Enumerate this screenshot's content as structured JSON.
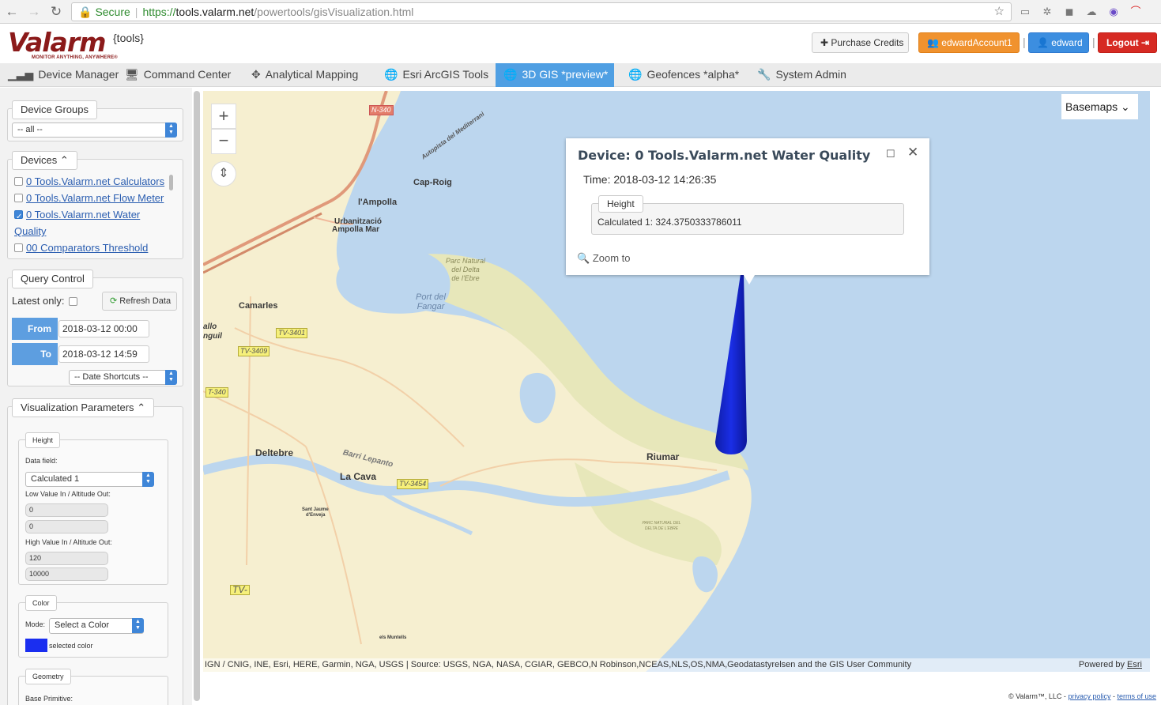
{
  "browser": {
    "secure_label": "Secure",
    "url_scheme": "https://",
    "url_host": "tools.valarm.net",
    "url_path": "/powertools/gisVisualization.html"
  },
  "header": {
    "logo_text": "Valarm",
    "logo_tagline": "MONITOR ANYTHING, ANYWHERE®",
    "tools_tag": "{tools}",
    "purchase_label": "Purchase Credits",
    "account_label": "edwardAccount1",
    "user_label": "edward",
    "logout_label": "Logout"
  },
  "tabs": [
    {
      "label": "Device Manager",
      "icon": "signal-bars-icon"
    },
    {
      "label": "Command Center",
      "icon": "monitor-icon"
    },
    {
      "label": "Analytical Mapping",
      "icon": "crosshair-icon"
    },
    {
      "label": "Esri ArcGIS Tools",
      "icon": "globe-icon"
    },
    {
      "label": "3D GIS *preview*",
      "icon": "globe-icon",
      "active": true
    },
    {
      "label": "Geofences *alpha*",
      "icon": "globe-icon"
    },
    {
      "label": "System Admin",
      "icon": "wrench-icon"
    }
  ],
  "sidebar": {
    "device_groups": {
      "legend": "Device Groups",
      "selected": "-- all --"
    },
    "devices": {
      "legend": "Devices",
      "items": [
        {
          "label": "0 Tools.Valarm.net Calculators",
          "checked": false
        },
        {
          "label": "0 Tools.Valarm.net Flow Meter",
          "checked": false
        },
        {
          "label": "0 Tools.Valarm.net Water",
          "label_cont": "Quality",
          "checked": true
        },
        {
          "label": "00 Comparators Threshold",
          "checked": false
        }
      ]
    },
    "query": {
      "legend": "Query Control",
      "latest_only": "Latest only:",
      "refresh": "Refresh Data",
      "from_label": "From",
      "from_value": "2018-03-12 00:00",
      "to_label": "To",
      "to_value": "2018-03-12 14:59",
      "shortcuts": "-- Date Shortcuts --"
    },
    "viz": {
      "legend": "Visualization Parameters",
      "height_legend": "Height",
      "data_field_label": "Data field:",
      "data_field_value": "Calculated 1",
      "low_label": "Low Value In / Altitude Out:",
      "low_in": "0",
      "low_out": "0",
      "high_label": "High Value In / Altitude Out:",
      "high_in": "120",
      "high_out": "10000",
      "color_legend": "Color",
      "mode_label": "Mode:",
      "mode_value": "Select a Color",
      "selected_color_label": "selected color",
      "selected_color": "#1a2ef0",
      "geometry_legend": "Geometry",
      "base_primitive_label": "Base Primitive:"
    }
  },
  "map": {
    "basemaps_label": "Basemaps",
    "popup": {
      "title": "Device: 0 Tools.Valarm.net Water Quality",
      "time": "Time: 2018-03-12 14:26:35",
      "field_legend": "Height",
      "value": "Calculated 1: 324.3750333786011",
      "zoom": "Zoom to"
    },
    "labels": {
      "cap_roig": "Cap-Roig",
      "lampolla": "l'Ampolla",
      "urbanitzacio": "Urbanització",
      "ampolla_mar": "Ampolla Mar",
      "camarles": "Camarles",
      "deltebre": "Deltebre",
      "la_cava": "La Cava",
      "barri": "Barri Lepanto",
      "riumar": "Riumar",
      "allo": "allo",
      "nguil": "nguil",
      "sant_jaume": "Sant Jaume",
      "denveja": "d'Enveja",
      "els_muntells": "els Muntells",
      "autopista": "Autopista del Mediterrani",
      "parc1": "Parc Natural",
      "parc2": "del Delta",
      "parc3": "de l'Ebre",
      "port1": "Port del",
      "port2": "Fangar",
      "parc_s1": "PARC NATURAL DEL",
      "parc_s2": "DELTA DE L'EBRE",
      "road_n340": "N-340",
      "road_tv3401": "TV-3401",
      "road_tv3409": "TV-3409",
      "road_t340": "T-340",
      "road_tv3454": "TV-3454",
      "road_tv": "TV-"
    },
    "attribution": "IGN / CNIG, INE, Esri, HERE, Garmin, NGA, USGS | Source: USGS, NGA, NASA, CGIAR, GEBCO,N Robinson,NCEAS,NLS,OS,NMA,Geodatastyrelsen and the GIS User Community",
    "powered_prefix": "Powered by ",
    "powered_link": "Esri",
    "bar_color": "#1a2ad8"
  },
  "footer": {
    "copyright": "© Valarm™, LLC - ",
    "privacy": "privacy policy",
    "dash": " - ",
    "terms": "terms of use"
  }
}
